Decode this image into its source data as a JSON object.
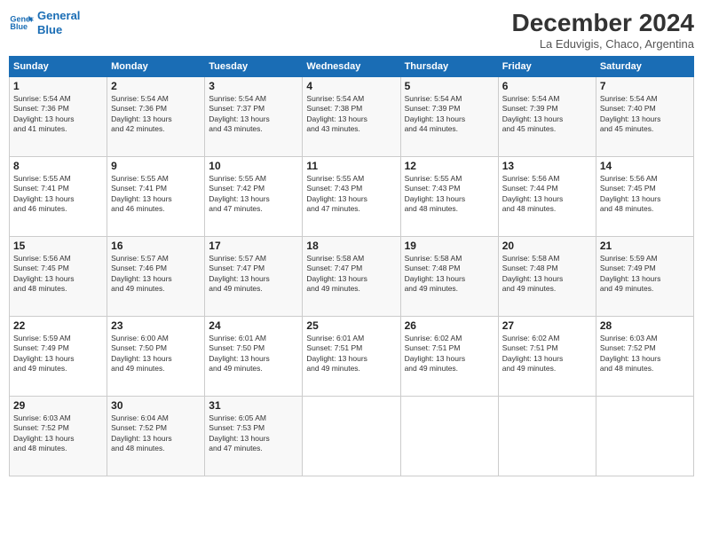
{
  "logo": {
    "line1": "General",
    "line2": "Blue"
  },
  "title": "December 2024",
  "subtitle": "La Eduvigis, Chaco, Argentina",
  "days_of_week": [
    "Sunday",
    "Monday",
    "Tuesday",
    "Wednesday",
    "Thursday",
    "Friday",
    "Saturday"
  ],
  "weeks": [
    [
      {
        "day": "1",
        "info": "Sunrise: 5:54 AM\nSunset: 7:36 PM\nDaylight: 13 hours\nand 41 minutes."
      },
      {
        "day": "2",
        "info": "Sunrise: 5:54 AM\nSunset: 7:36 PM\nDaylight: 13 hours\nand 42 minutes."
      },
      {
        "day": "3",
        "info": "Sunrise: 5:54 AM\nSunset: 7:37 PM\nDaylight: 13 hours\nand 43 minutes."
      },
      {
        "day": "4",
        "info": "Sunrise: 5:54 AM\nSunset: 7:38 PM\nDaylight: 13 hours\nand 43 minutes."
      },
      {
        "day": "5",
        "info": "Sunrise: 5:54 AM\nSunset: 7:39 PM\nDaylight: 13 hours\nand 44 minutes."
      },
      {
        "day": "6",
        "info": "Sunrise: 5:54 AM\nSunset: 7:39 PM\nDaylight: 13 hours\nand 45 minutes."
      },
      {
        "day": "7",
        "info": "Sunrise: 5:54 AM\nSunset: 7:40 PM\nDaylight: 13 hours\nand 45 minutes."
      }
    ],
    [
      {
        "day": "8",
        "info": "Sunrise: 5:55 AM\nSunset: 7:41 PM\nDaylight: 13 hours\nand 46 minutes."
      },
      {
        "day": "9",
        "info": "Sunrise: 5:55 AM\nSunset: 7:41 PM\nDaylight: 13 hours\nand 46 minutes."
      },
      {
        "day": "10",
        "info": "Sunrise: 5:55 AM\nSunset: 7:42 PM\nDaylight: 13 hours\nand 47 minutes."
      },
      {
        "day": "11",
        "info": "Sunrise: 5:55 AM\nSunset: 7:43 PM\nDaylight: 13 hours\nand 47 minutes."
      },
      {
        "day": "12",
        "info": "Sunrise: 5:55 AM\nSunset: 7:43 PM\nDaylight: 13 hours\nand 48 minutes."
      },
      {
        "day": "13",
        "info": "Sunrise: 5:56 AM\nSunset: 7:44 PM\nDaylight: 13 hours\nand 48 minutes."
      },
      {
        "day": "14",
        "info": "Sunrise: 5:56 AM\nSunset: 7:45 PM\nDaylight: 13 hours\nand 48 minutes."
      }
    ],
    [
      {
        "day": "15",
        "info": "Sunrise: 5:56 AM\nSunset: 7:45 PM\nDaylight: 13 hours\nand 48 minutes."
      },
      {
        "day": "16",
        "info": "Sunrise: 5:57 AM\nSunset: 7:46 PM\nDaylight: 13 hours\nand 49 minutes."
      },
      {
        "day": "17",
        "info": "Sunrise: 5:57 AM\nSunset: 7:47 PM\nDaylight: 13 hours\nand 49 minutes."
      },
      {
        "day": "18",
        "info": "Sunrise: 5:58 AM\nSunset: 7:47 PM\nDaylight: 13 hours\nand 49 minutes."
      },
      {
        "day": "19",
        "info": "Sunrise: 5:58 AM\nSunset: 7:48 PM\nDaylight: 13 hours\nand 49 minutes."
      },
      {
        "day": "20",
        "info": "Sunrise: 5:58 AM\nSunset: 7:48 PM\nDaylight: 13 hours\nand 49 minutes."
      },
      {
        "day": "21",
        "info": "Sunrise: 5:59 AM\nSunset: 7:49 PM\nDaylight: 13 hours\nand 49 minutes."
      }
    ],
    [
      {
        "day": "22",
        "info": "Sunrise: 5:59 AM\nSunset: 7:49 PM\nDaylight: 13 hours\nand 49 minutes."
      },
      {
        "day": "23",
        "info": "Sunrise: 6:00 AM\nSunset: 7:50 PM\nDaylight: 13 hours\nand 49 minutes."
      },
      {
        "day": "24",
        "info": "Sunrise: 6:01 AM\nSunset: 7:50 PM\nDaylight: 13 hours\nand 49 minutes."
      },
      {
        "day": "25",
        "info": "Sunrise: 6:01 AM\nSunset: 7:51 PM\nDaylight: 13 hours\nand 49 minutes."
      },
      {
        "day": "26",
        "info": "Sunrise: 6:02 AM\nSunset: 7:51 PM\nDaylight: 13 hours\nand 49 minutes."
      },
      {
        "day": "27",
        "info": "Sunrise: 6:02 AM\nSunset: 7:51 PM\nDaylight: 13 hours\nand 49 minutes."
      },
      {
        "day": "28",
        "info": "Sunrise: 6:03 AM\nSunset: 7:52 PM\nDaylight: 13 hours\nand 48 minutes."
      }
    ],
    [
      {
        "day": "29",
        "info": "Sunrise: 6:03 AM\nSunset: 7:52 PM\nDaylight: 13 hours\nand 48 minutes."
      },
      {
        "day": "30",
        "info": "Sunrise: 6:04 AM\nSunset: 7:52 PM\nDaylight: 13 hours\nand 48 minutes."
      },
      {
        "day": "31",
        "info": "Sunrise: 6:05 AM\nSunset: 7:53 PM\nDaylight: 13 hours\nand 47 minutes."
      },
      {
        "day": "",
        "info": ""
      },
      {
        "day": "",
        "info": ""
      },
      {
        "day": "",
        "info": ""
      },
      {
        "day": "",
        "info": ""
      }
    ]
  ]
}
